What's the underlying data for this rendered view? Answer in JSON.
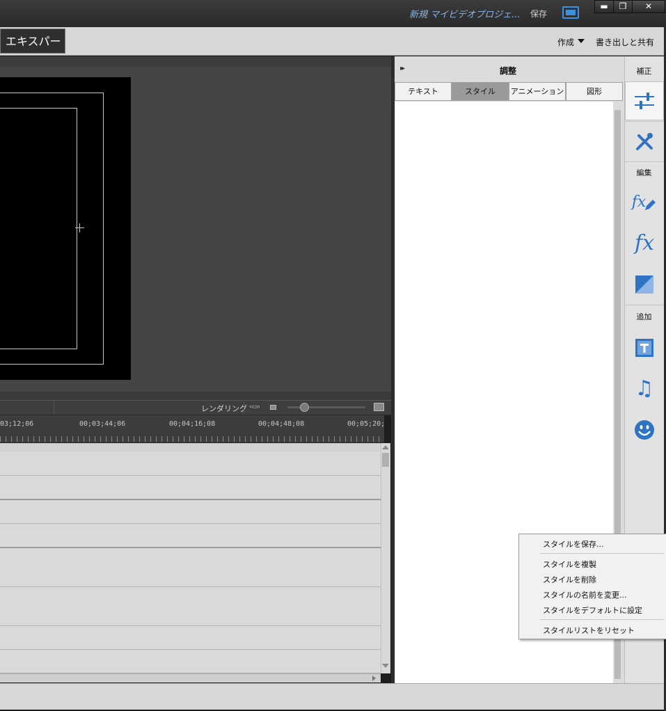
{
  "titlebar": {
    "project_title": "新規 マイビデオプロジェ...",
    "save_label": "保存",
    "minimize_label": "▬",
    "restore_label": "❐",
    "close_label": "✕"
  },
  "modebar": {
    "mode_label": "エキスパート",
    "create_label": "作成",
    "export_label": "書き出しと共有"
  },
  "timeline": {
    "render_label": "レンダリング",
    "render_icon": "‹▭›",
    "timecodes": [
      "03;12;06",
      "00;03;44;06",
      "00;04;16;08",
      "00;04;48;08",
      "00;05;20;"
    ]
  },
  "adjust_panel": {
    "collapse_glyph": "▸▸",
    "title": "調整",
    "tabs": [
      {
        "label": "テキスト",
        "active": false
      },
      {
        "label": "スタイル",
        "active": true
      },
      {
        "label": "アニメーション",
        "active": false
      },
      {
        "label": "図形",
        "active": false
      }
    ]
  },
  "rail": {
    "sections": {
      "adjust": "補正",
      "edit": "編集",
      "add": "追加"
    },
    "icons": [
      {
        "name": "adjust-sliders-icon",
        "glyph": "⊟"
      },
      {
        "name": "tools-icon",
        "glyph": "✕"
      },
      {
        "name": "applied-effects-icon",
        "glyph": "fx"
      },
      {
        "name": "effects-icon",
        "glyph": "fx"
      },
      {
        "name": "transitions-icon",
        "glyph": "◪"
      },
      {
        "name": "titles-icon",
        "glyph": "T"
      },
      {
        "name": "music-icon",
        "glyph": "♫"
      },
      {
        "name": "graphics-icon",
        "glyph": "☺"
      }
    ]
  },
  "context_menu": {
    "items": [
      "スタイルを保存...",
      "スタイルを複製",
      "スタイルを削除",
      "スタイルの名前を変更...",
      "スタイルをデフォルトに設定",
      "スタイルリストをリセット"
    ]
  },
  "colors": {
    "accent": "#2f73c4",
    "title_text": "#8ab4e8"
  }
}
